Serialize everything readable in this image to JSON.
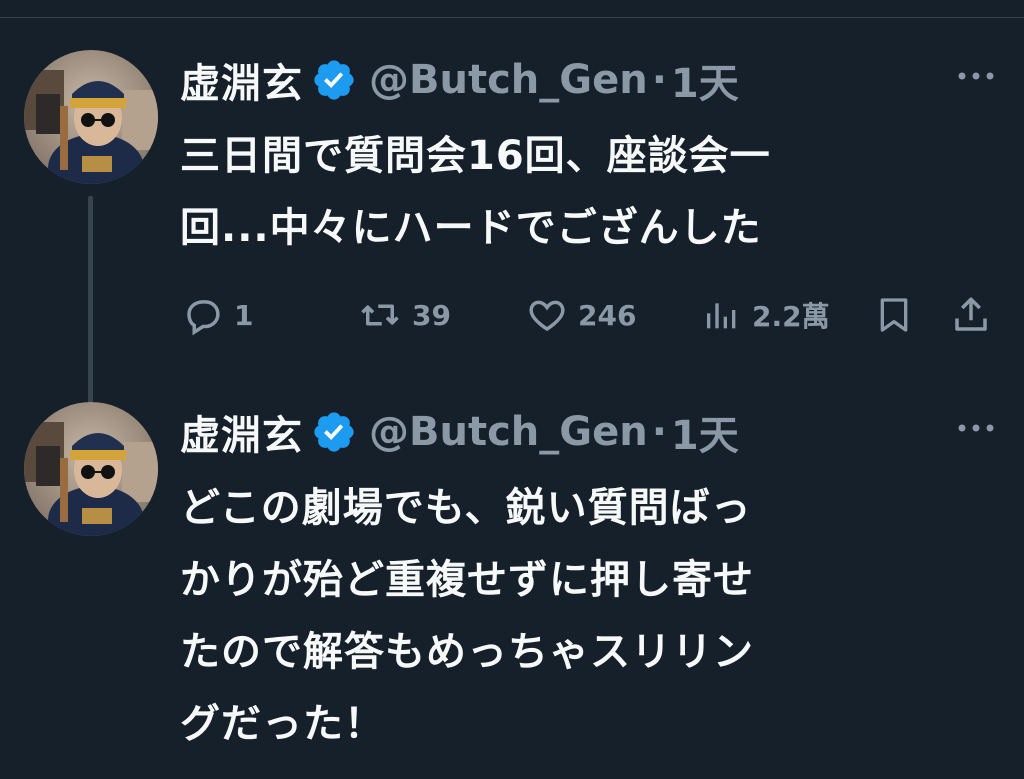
{
  "tweets": [
    {
      "display_name": "虚淵玄",
      "handle": "@Butch_Gen",
      "separator": "·",
      "time": "1天",
      "lines": [
        "三日間で質問会16回、座談会一",
        "回...中々にハードでござんした"
      ],
      "stats": {
        "replies": "1",
        "retweets": "39",
        "likes": "246",
        "views": "2.2萬"
      }
    },
    {
      "display_name": "虚淵玄",
      "handle": "@Butch_Gen",
      "separator": "·",
      "time": "1天",
      "lines": [
        "どこの劇場でも、鋭い質問ばっ",
        "かりが殆ど重複せずに押し寄せ",
        "たので解答もめっちゃスリリン",
        "グだった！"
      ]
    }
  ],
  "colors": {
    "background": "#15202b",
    "text": "#f7f9f9",
    "muted": "#8b98a5",
    "verified": "#1d9bf0",
    "divider": "#38444d"
  },
  "icons": [
    "verified-badge-icon",
    "more-icon",
    "reply-icon",
    "retweet-icon",
    "like-icon",
    "views-icon",
    "bookmark-icon",
    "share-icon"
  ]
}
